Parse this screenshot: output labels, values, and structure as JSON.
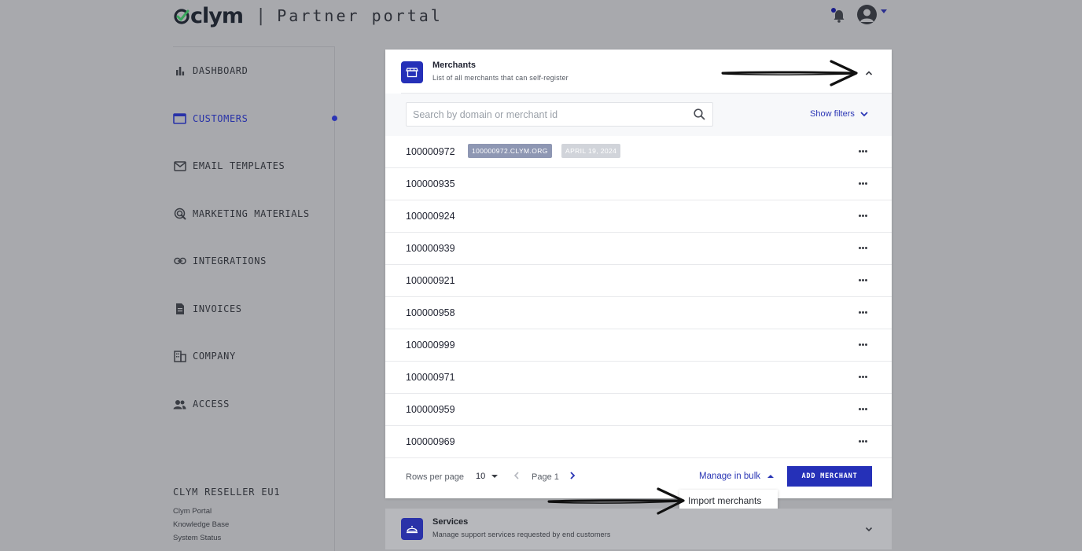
{
  "header": {
    "logo_text": "clym",
    "separator": "|",
    "subtitle": "Partner portal"
  },
  "sidebar": {
    "items": [
      {
        "label": "DASHBOARD",
        "icon": "bar-chart-icon"
      },
      {
        "label": "CUSTOMERS",
        "icon": "browser-window-icon",
        "active": true
      },
      {
        "label": "EMAIL TEMPLATES",
        "icon": "envelope-icon"
      },
      {
        "label": "MARKETING MATERIALS",
        "icon": "target-icon"
      },
      {
        "label": "INTEGRATIONS",
        "icon": "link-icon"
      },
      {
        "label": "INVOICES",
        "icon": "document-icon"
      },
      {
        "label": "COMPANY",
        "icon": "building-icon"
      },
      {
        "label": "ACCESS",
        "icon": "people-icon"
      }
    ],
    "reseller": "CLYM RESELLER EU1",
    "footer_links": [
      "Clym Portal",
      "Knowledge Base",
      "System Status"
    ]
  },
  "merchants": {
    "title": "Merchants",
    "subtitle": "List of all merchants that can self-register",
    "search_placeholder": "Search by domain or merchant id",
    "show_filters": "Show filters",
    "rows": [
      {
        "id": "100000972",
        "domain": "100000972.CLYM.ORG",
        "date": "APRIL 19, 2024"
      },
      {
        "id": "100000935"
      },
      {
        "id": "100000924"
      },
      {
        "id": "100000939"
      },
      {
        "id": "100000921"
      },
      {
        "id": "100000958"
      },
      {
        "id": "100000999"
      },
      {
        "id": "100000971"
      },
      {
        "id": "100000959"
      },
      {
        "id": "100000969"
      }
    ],
    "rows_per_page_label": "Rows per page",
    "rows_per_page": "10",
    "page_label": "Page 1",
    "manage_bulk": "Manage in bulk",
    "add_button": "ADD MERCHANT",
    "bulk_menu": [
      "Import merchants"
    ]
  },
  "services": {
    "title": "Services",
    "subtitle": "Manage support services requested by end customers"
  },
  "colors": {
    "accent": "#2530b8",
    "link": "#2a36b5",
    "overlay_bg": "#a8a9ad"
  }
}
